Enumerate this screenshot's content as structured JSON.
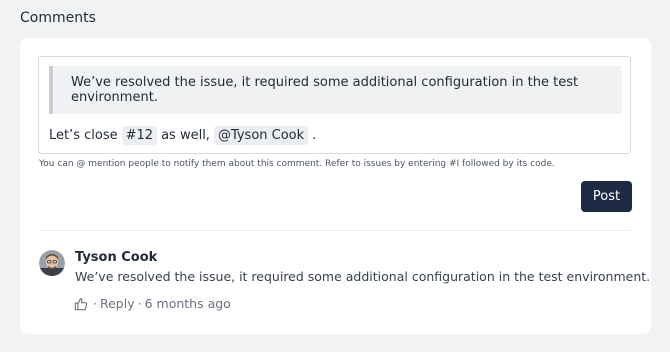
{
  "section": {
    "title": "Comments"
  },
  "editor": {
    "quote": "We’ve resolved the issue, it required some additional configuration in the test environment.",
    "line_prefix": "Let’s close",
    "issue_mention": "#12",
    "line_middle": "as well,",
    "user_mention": "@Tyson Cook",
    "line_suffix": "."
  },
  "help_text": "You can @ mention people to notify them about this comment. Refer to issues by entering #I followed by its code.",
  "post_button": {
    "label": "Post"
  },
  "comment": {
    "author": "Tyson Cook",
    "body": "We’ve resolved the issue, it required some additional configuration in the test environment.",
    "separator": "·",
    "reply_label": "Reply",
    "time": "6 months ago"
  },
  "icons": {
    "like": "thumbs-up-icon",
    "avatar": "user-avatar"
  },
  "colors": {
    "button_bg": "#1e2a44",
    "page_bg": "#f1f2f4",
    "chip_bg": "#eceef1"
  }
}
